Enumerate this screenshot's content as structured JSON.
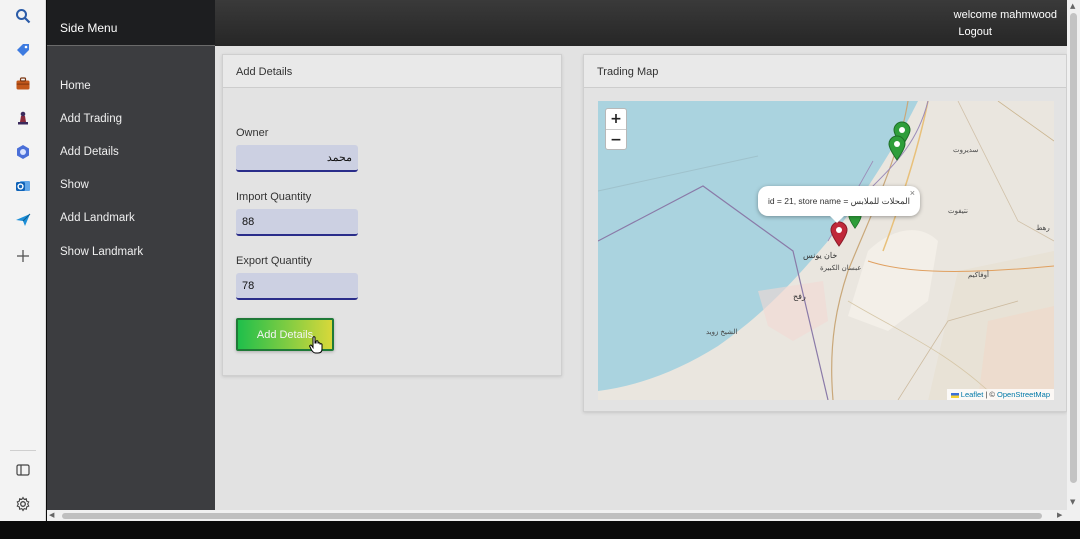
{
  "side_menu": {
    "title": "Side Menu",
    "items": [
      {
        "label": "Home"
      },
      {
        "label": "Add Trading"
      },
      {
        "label": "Add Details"
      },
      {
        "label": "Show"
      },
      {
        "label": "Add Landmark"
      },
      {
        "label": "Show Landmark"
      }
    ]
  },
  "header": {
    "welcome": "welcome mahmwood",
    "logout": "Logout"
  },
  "details_panel": {
    "title": "Add Details",
    "owner_label": "Owner",
    "owner_value": "محمد",
    "import_label": "Import Quantity",
    "import_value": "88",
    "export_label": "Export Quantity",
    "export_value": "78",
    "submit_label": "Add Details"
  },
  "map_panel": {
    "title": "Trading Map",
    "zoom_in": "+",
    "zoom_out": "−",
    "popup_text": "id = 21, store name = المحلات للملابس",
    "popup_close": "×",
    "attribution_leaflet": "Leaflet",
    "attribution_sep": " | © ",
    "attribution_osm": "OpenStreetMap",
    "place_labels": [
      "خان يونس",
      "عبسان الكبيرة",
      "رفح",
      "الشيخ زويد",
      "سديروت",
      "نتيفوت",
      "أوفاكيم",
      "رهط"
    ]
  },
  "colors": {
    "sidebar_bg": "#3c3d40",
    "topbar_bg": "#262626",
    "button_gradient_start": "#1fbf4b",
    "button_gradient_end": "#d8d83a",
    "input_bg": "#ccd0e2",
    "input_border": "#2a2d8a",
    "marker_red": "#c0283a",
    "marker_green": "#2e9e3a"
  },
  "browser_icons": [
    "search-icon",
    "tag-icon",
    "briefcase-icon",
    "chess-icon",
    "copilot-icon",
    "outlook-icon",
    "send-icon",
    "add-icon",
    "sidebar-toggle-icon",
    "settings-icon"
  ]
}
